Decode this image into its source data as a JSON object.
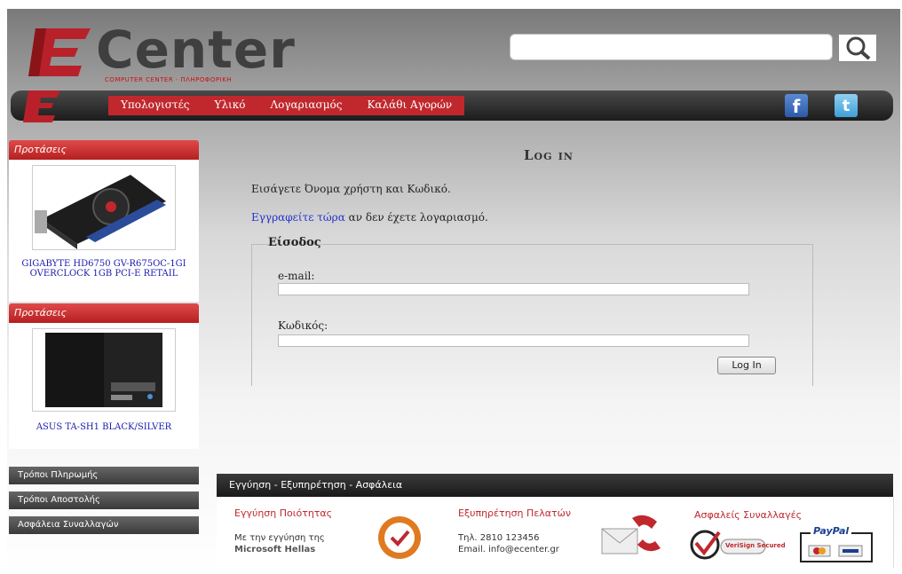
{
  "header": {
    "logo_text": "Center",
    "logo_tagline": "COMPUTER CENTER · ΠΛΗΡΟΦΟΡΙΚΗ",
    "search_placeholder": ""
  },
  "nav": {
    "items": [
      "Υπολογιστές",
      "Υλικό",
      "Λογαριασμός",
      "Καλάθι Αγορών"
    ],
    "facebook_glyph": "f",
    "twitter_glyph": "t"
  },
  "sidebar": {
    "section_title_1": "Προτάσεις",
    "product_1_name": "GIGABYTE HD6750 GV-R675OC-1GI OVERCLOCK 1GB PCI-E RETAIL",
    "section_title_2": "Προτάσεις",
    "product_2_name": "ASUS TA-SH1 BLACK/SILVER",
    "menu": [
      "Τρόποι Πληρωμής",
      "Τρόποι Αποστολής",
      "Ασφάλεια Συναλλαγών"
    ]
  },
  "main": {
    "title": "Log in",
    "intro": "Εισάγετε Όνομα χρήστη και Κωδικό.",
    "register_link": "Εγγραφείτε τώρα",
    "register_rest": " αν δεν έχετε λογαριασμό.",
    "legend": "Είσοδος",
    "email_label": "e-mail:",
    "email_value": "",
    "password_label": "Κωδικός:",
    "password_value": "",
    "login_button": "Log In"
  },
  "footer": {
    "bar_title": "Εγγύηση - Εξυπηρέτηση - Ασφάλεια",
    "warranty_title": "Εγγύηση Ποιότητας",
    "warranty_text_1": "Με την εγγύηση της",
    "warranty_text_2": "Microsoft Hellas",
    "support_title": "Εξυπηρέτηση Πελατών",
    "support_phone": "Τηλ. 2810 123456",
    "support_email": "Email. info@ecenter.gr",
    "secure_title": "Ασφαλείς Συναλλαγές",
    "verisign_label": "VeriSign Secured",
    "paypal_label": "PayPal"
  },
  "colors": {
    "brand_red": "#c0282d",
    "nav_dark": "#1c1c1c",
    "link_blue": "#2233cc"
  }
}
